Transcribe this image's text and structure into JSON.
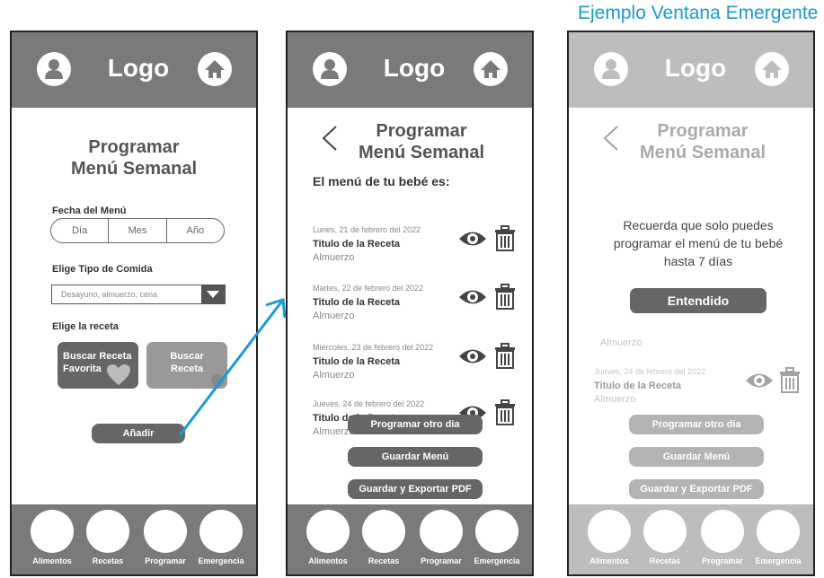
{
  "caption": "Ejemplo Ventana Emergente",
  "header": {
    "logo": "Logo",
    "avatar_icon": "user-avatar-icon",
    "home_icon": "home-icon"
  },
  "nav": {
    "items": [
      "Alimentos",
      "Recetas",
      "Programar",
      "Emergencia"
    ]
  },
  "screen1": {
    "title_line1": "Programar",
    "title_line2": "Menú Semanal",
    "date_label": "Fecha del Menú",
    "date_parts": [
      "Día",
      "Mes",
      "Año"
    ],
    "meal_label": "Elige Tipo de Comida",
    "meal_placeholder": "Desayuno, almuerzo, cena",
    "recipe_label": "Elige la receta",
    "fav_button": "Buscar Receta Favorita",
    "search_button": "Buscar Receta",
    "add_button": "Añadir"
  },
  "screen2": {
    "title_line1": "Programar",
    "title_line2": "Menú Semanal",
    "intro": "El menú de tu bebé es:",
    "items": [
      {
        "date": "Lunes, 21 de febrero del 2022",
        "title": "Titulo de la Receta",
        "meal": "Almuerzo"
      },
      {
        "date": "Martes, 22 de febrero del 2022",
        "title": "Titulo de la Receta",
        "meal": "Almuerzo"
      },
      {
        "date": "Miércoles, 23 de febrero del 2022",
        "title": "Titulo de la Receta",
        "meal": "Almuerzo"
      },
      {
        "date": "Jueves, 24 de febrero del 2022",
        "title": "Titulo de la Receta",
        "meal": "Almuerzo"
      }
    ],
    "buttons": [
      "Programar otro dia",
      "Guardar Menú",
      "Guardar y Exportar PDF"
    ]
  },
  "screen3": {
    "behind_meal": "Almuerzo",
    "popup_message": "Recuerda que solo puedes programar el menú de tu bebé hasta 7 días",
    "popup_button": "Entendido"
  },
  "colors": {
    "header": "#7a7a7a",
    "button": "#666666",
    "caption": "#1a9ad6",
    "arrow": "#1a9ad6"
  }
}
